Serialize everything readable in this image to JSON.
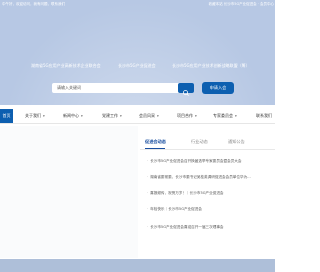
{
  "topbar": {
    "left_text": "中午好，欢迎访问，我有问题，联系我们",
    "right_text": "收藏本站 长沙市5G产业促进会 · 会员中心"
  },
  "orgs": [
    "湖南省5G应用产业高新技术企业联合会",
    "长沙市5G产业促进会",
    "长沙市5G应用产业技术创新战略联盟（筹）"
  ],
  "search": {
    "placeholder": "请输入关键词",
    "button_icon": "search-icon"
  },
  "join_button": "申请入会",
  "nav": {
    "home": "首页",
    "items": [
      {
        "label": "关于我们",
        "has_dropdown": true
      },
      {
        "label": "新闻中心",
        "has_dropdown": true
      },
      {
        "label": "党建工作",
        "has_dropdown": true
      },
      {
        "label": "会员风采",
        "has_dropdown": true
      },
      {
        "label": "项目合作",
        "has_dropdown": true
      },
      {
        "label": "专家委员会",
        "has_dropdown": true
      },
      {
        "label": "联系我们",
        "has_dropdown": false
      }
    ]
  },
  "tabs": [
    {
      "label": "促进会动态",
      "active": true
    },
    {
      "label": "行业动态",
      "active": false
    },
    {
      "label": "通知公告",
      "active": false
    }
  ],
  "news": [
    "长沙市5G产业促进会召开换届选举专家委员会暨会员大会",
    "湖南省委常委、长沙市委书记吴桂英调研促进会会员单位华为…",
    "喜报频传，祝贺万岁！｜长沙市5G产业促进会",
    "年检快乐｜长沙市5G产业促进会",
    "长沙市5G产业促进会喜迎召开一届三次理事会"
  ],
  "colors": {
    "hero_bg": "#b7c8e4",
    "accent": "#0d5fb0",
    "tab_active": "#1a4fa0",
    "footer_bg": "#aebfd9"
  }
}
